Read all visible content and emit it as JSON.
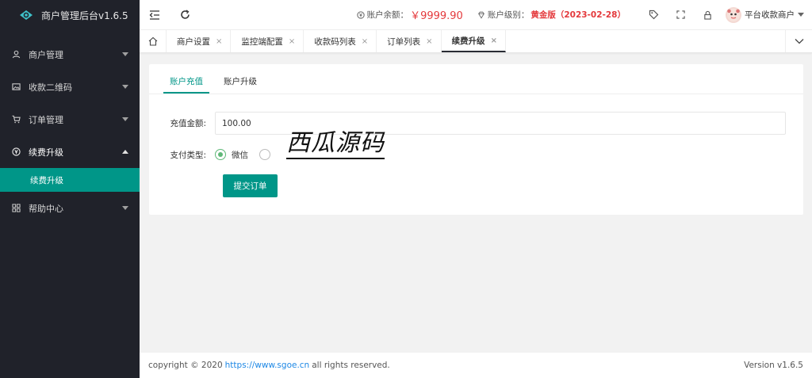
{
  "app": {
    "title": "商户管理后台v1.6.5"
  },
  "sidebar": {
    "items": [
      {
        "label": "商户管理",
        "icon": "user-icon"
      },
      {
        "label": "收款二维码",
        "icon": "image-icon"
      },
      {
        "label": "订单管理",
        "icon": "cart-icon"
      },
      {
        "label": "续费升级",
        "icon": "yen-circle-icon",
        "open": true,
        "children": [
          {
            "label": "续费升级"
          }
        ]
      },
      {
        "label": "帮助中心",
        "icon": "grid-icon"
      }
    ]
  },
  "header": {
    "balance_label": "账户余额：",
    "balance_value": "￥9999.90",
    "level_label": "账户级别：",
    "level_value": "黄金版（2023-02-28）",
    "user_name": "平台收款商户"
  },
  "tabs": {
    "items": [
      "商户设置",
      "监控端配置",
      "收款码列表",
      "订单列表",
      "续费升级"
    ],
    "active_index": 4,
    "close_glyph": "×"
  },
  "page": {
    "subtabs": [
      "账户充值",
      "账户升级"
    ],
    "active_subtab": 0,
    "form": {
      "amount_label": "充值金额:",
      "amount_value": "100.00",
      "pay_type_label": "支付类型:",
      "pay_options": [
        "微信",
        ""
      ],
      "pay_selected": 0,
      "submit_label": "提交订单"
    },
    "watermark": "西瓜源码"
  },
  "footer": {
    "copyright_prefix": "copyright © 2020",
    "link": "https://www.sgoe.cn",
    "copyright_suffix": "all rights reserved.",
    "version": "Version v1.6.5"
  },
  "colors": {
    "sidebar_bg": "#20222a",
    "accent": "#009688",
    "money_red": "#e4393c",
    "radio_green": "#5fb878"
  }
}
